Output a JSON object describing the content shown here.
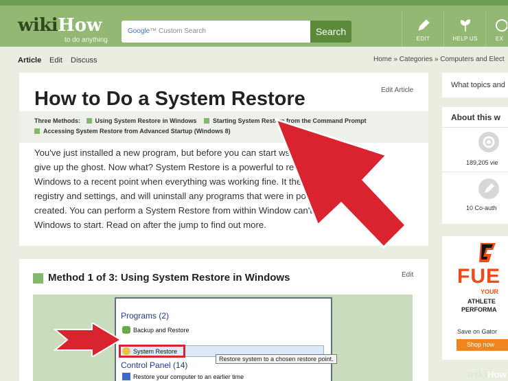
{
  "header": {
    "logo_wiki": "wiki",
    "logo_how": "How",
    "logo_tagline": "to do anything",
    "search_provider": "Google",
    "search_placeholder": "Custom Search",
    "search_button": "Search",
    "actions": [
      {
        "label": "EDIT",
        "icon": "pencil-icon"
      },
      {
        "label": "HELP US",
        "icon": "sprout-icon"
      },
      {
        "label": "EX",
        "icon": "explore-icon"
      }
    ]
  },
  "tabs": {
    "article": "Article",
    "edit": "Edit",
    "discuss": "Discuss"
  },
  "breadcrumb": "Home » Categories » Computers and Elect",
  "article": {
    "title": "How to Do a System Restore",
    "edit_link": "Edit Article",
    "methods_label": "Three Methods:",
    "methods": [
      "Using System Restore in Windows",
      "Starting System Restore from the Command Prompt",
      "Accessing System Restore from Advanced Startup (Windows 8)"
    ],
    "intro_lines": [
      "You've just installed a new program, but before you can start               ws decides to",
      "give up the ghost. Now what? System Restore is a powerful to                     revert",
      "Windows to a recent point when everything was working fine. It                        the",
      "registry and settings, and will uninstall any programs that were in                point was",
      "created. You can perform a System Restore from within Window                 can't get",
      "Windows to start. Read on after the jump to find out more."
    ]
  },
  "method": {
    "title": "Method 1 of 3: Using System Restore in Windows",
    "edit": "Edit",
    "screenshot": {
      "programs_heading": "Programs (2)",
      "item1": "Backup and Restore",
      "item2": "System Restore",
      "control_panel_heading": "Control Panel (14)",
      "item3": "Restore your computer to an earlier time",
      "tooltip": "Restore system to a chosen restore point."
    }
  },
  "sidebar": {
    "question": "What topics and",
    "about_title": "About this w",
    "views": "189,205 vie",
    "coauthors": "10 Co-auth",
    "ad": {
      "brand_letter": "G",
      "fuel": "FUE",
      "line1": "YOUR",
      "line2": "ATHLETE",
      "line3": "PERFORMA",
      "save": "Save on Gator",
      "shop": "Shop now"
    }
  },
  "watermark": {
    "wiki": "wiki",
    "how": "How"
  },
  "colors": {
    "header_green": "#93b874",
    "accent_green": "#84b86a",
    "arrow_red": "#d9232e",
    "fuel_orange": "#ee4a1a"
  }
}
